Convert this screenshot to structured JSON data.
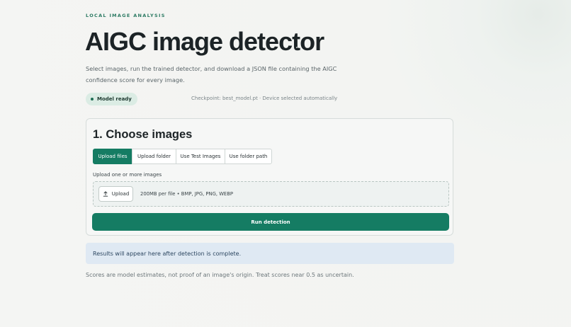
{
  "header": {
    "eyebrow": "LOCAL IMAGE ANALYSIS",
    "title": "AIGC image detector",
    "subtitle": "Select images, run the trained detector, and download a JSON file containing the AIGC confidence score for every image."
  },
  "status": {
    "badge": "Model ready",
    "checkpoint": "Checkpoint: best_model.pt · Device selected automatically"
  },
  "choose_images": {
    "title": "1. Choose images",
    "tabs": [
      {
        "label": "Upload files",
        "active": true
      },
      {
        "label": "Upload folder",
        "active": false
      },
      {
        "label": "Use Test Images",
        "active": false
      },
      {
        "label": "Use folder path",
        "active": false
      }
    ],
    "upload_label": "Upload one or more images",
    "upload_button": "Upload",
    "upload_icon": "upload-icon",
    "dropzone_hint": "200MB per file • BMP, JPG, PNG, WEBP",
    "run_button": "Run detection"
  },
  "results": {
    "placeholder": "Results will appear here after detection is complete."
  },
  "footnote": "Scores are model estimates, not proof of an image's origin. Treat scores near 0.5 as uncertain.",
  "colors": {
    "accent": "#157c63",
    "badge_bg": "#dbece4",
    "info_bg": "#dfe9f3"
  }
}
